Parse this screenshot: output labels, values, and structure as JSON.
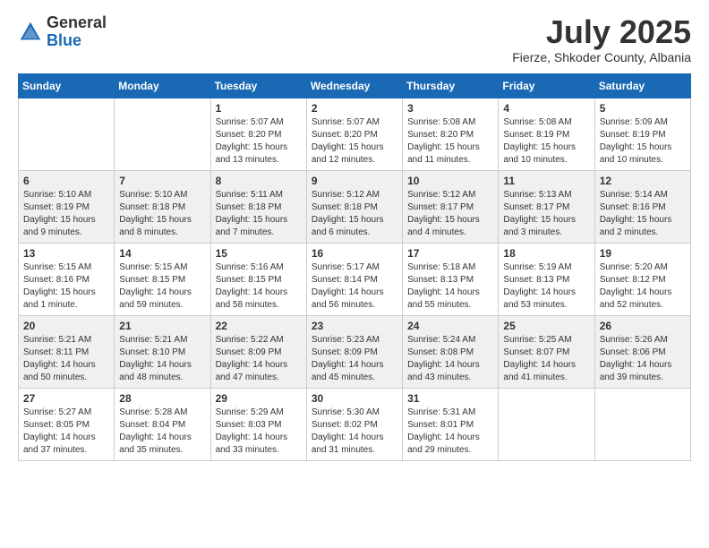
{
  "header": {
    "logo_general": "General",
    "logo_blue": "Blue",
    "month_title": "July 2025",
    "location": "Fierze, Shkoder County, Albania"
  },
  "weekdays": [
    "Sunday",
    "Monday",
    "Tuesday",
    "Wednesday",
    "Thursday",
    "Friday",
    "Saturday"
  ],
  "weeks": [
    [
      {
        "day": "",
        "sunrise": "",
        "sunset": "",
        "daylight": ""
      },
      {
        "day": "",
        "sunrise": "",
        "sunset": "",
        "daylight": ""
      },
      {
        "day": "1",
        "sunrise": "Sunrise: 5:07 AM",
        "sunset": "Sunset: 8:20 PM",
        "daylight": "Daylight: 15 hours and 13 minutes."
      },
      {
        "day": "2",
        "sunrise": "Sunrise: 5:07 AM",
        "sunset": "Sunset: 8:20 PM",
        "daylight": "Daylight: 15 hours and 12 minutes."
      },
      {
        "day": "3",
        "sunrise": "Sunrise: 5:08 AM",
        "sunset": "Sunset: 8:20 PM",
        "daylight": "Daylight: 15 hours and 11 minutes."
      },
      {
        "day": "4",
        "sunrise": "Sunrise: 5:08 AM",
        "sunset": "Sunset: 8:19 PM",
        "daylight": "Daylight: 15 hours and 10 minutes."
      },
      {
        "day": "5",
        "sunrise": "Sunrise: 5:09 AM",
        "sunset": "Sunset: 8:19 PM",
        "daylight": "Daylight: 15 hours and 10 minutes."
      }
    ],
    [
      {
        "day": "6",
        "sunrise": "Sunrise: 5:10 AM",
        "sunset": "Sunset: 8:19 PM",
        "daylight": "Daylight: 15 hours and 9 minutes."
      },
      {
        "day": "7",
        "sunrise": "Sunrise: 5:10 AM",
        "sunset": "Sunset: 8:18 PM",
        "daylight": "Daylight: 15 hours and 8 minutes."
      },
      {
        "day": "8",
        "sunrise": "Sunrise: 5:11 AM",
        "sunset": "Sunset: 8:18 PM",
        "daylight": "Daylight: 15 hours and 7 minutes."
      },
      {
        "day": "9",
        "sunrise": "Sunrise: 5:12 AM",
        "sunset": "Sunset: 8:18 PM",
        "daylight": "Daylight: 15 hours and 6 minutes."
      },
      {
        "day": "10",
        "sunrise": "Sunrise: 5:12 AM",
        "sunset": "Sunset: 8:17 PM",
        "daylight": "Daylight: 15 hours and 4 minutes."
      },
      {
        "day": "11",
        "sunrise": "Sunrise: 5:13 AM",
        "sunset": "Sunset: 8:17 PM",
        "daylight": "Daylight: 15 hours and 3 minutes."
      },
      {
        "day": "12",
        "sunrise": "Sunrise: 5:14 AM",
        "sunset": "Sunset: 8:16 PM",
        "daylight": "Daylight: 15 hours and 2 minutes."
      }
    ],
    [
      {
        "day": "13",
        "sunrise": "Sunrise: 5:15 AM",
        "sunset": "Sunset: 8:16 PM",
        "daylight": "Daylight: 15 hours and 1 minute."
      },
      {
        "day": "14",
        "sunrise": "Sunrise: 5:15 AM",
        "sunset": "Sunset: 8:15 PM",
        "daylight": "Daylight: 14 hours and 59 minutes."
      },
      {
        "day": "15",
        "sunrise": "Sunrise: 5:16 AM",
        "sunset": "Sunset: 8:15 PM",
        "daylight": "Daylight: 14 hours and 58 minutes."
      },
      {
        "day": "16",
        "sunrise": "Sunrise: 5:17 AM",
        "sunset": "Sunset: 8:14 PM",
        "daylight": "Daylight: 14 hours and 56 minutes."
      },
      {
        "day": "17",
        "sunrise": "Sunrise: 5:18 AM",
        "sunset": "Sunset: 8:13 PM",
        "daylight": "Daylight: 14 hours and 55 minutes."
      },
      {
        "day": "18",
        "sunrise": "Sunrise: 5:19 AM",
        "sunset": "Sunset: 8:13 PM",
        "daylight": "Daylight: 14 hours and 53 minutes."
      },
      {
        "day": "19",
        "sunrise": "Sunrise: 5:20 AM",
        "sunset": "Sunset: 8:12 PM",
        "daylight": "Daylight: 14 hours and 52 minutes."
      }
    ],
    [
      {
        "day": "20",
        "sunrise": "Sunrise: 5:21 AM",
        "sunset": "Sunset: 8:11 PM",
        "daylight": "Daylight: 14 hours and 50 minutes."
      },
      {
        "day": "21",
        "sunrise": "Sunrise: 5:21 AM",
        "sunset": "Sunset: 8:10 PM",
        "daylight": "Daylight: 14 hours and 48 minutes."
      },
      {
        "day": "22",
        "sunrise": "Sunrise: 5:22 AM",
        "sunset": "Sunset: 8:09 PM",
        "daylight": "Daylight: 14 hours and 47 minutes."
      },
      {
        "day": "23",
        "sunrise": "Sunrise: 5:23 AM",
        "sunset": "Sunset: 8:09 PM",
        "daylight": "Daylight: 14 hours and 45 minutes."
      },
      {
        "day": "24",
        "sunrise": "Sunrise: 5:24 AM",
        "sunset": "Sunset: 8:08 PM",
        "daylight": "Daylight: 14 hours and 43 minutes."
      },
      {
        "day": "25",
        "sunrise": "Sunrise: 5:25 AM",
        "sunset": "Sunset: 8:07 PM",
        "daylight": "Daylight: 14 hours and 41 minutes."
      },
      {
        "day": "26",
        "sunrise": "Sunrise: 5:26 AM",
        "sunset": "Sunset: 8:06 PM",
        "daylight": "Daylight: 14 hours and 39 minutes."
      }
    ],
    [
      {
        "day": "27",
        "sunrise": "Sunrise: 5:27 AM",
        "sunset": "Sunset: 8:05 PM",
        "daylight": "Daylight: 14 hours and 37 minutes."
      },
      {
        "day": "28",
        "sunrise": "Sunrise: 5:28 AM",
        "sunset": "Sunset: 8:04 PM",
        "daylight": "Daylight: 14 hours and 35 minutes."
      },
      {
        "day": "29",
        "sunrise": "Sunrise: 5:29 AM",
        "sunset": "Sunset: 8:03 PM",
        "daylight": "Daylight: 14 hours and 33 minutes."
      },
      {
        "day": "30",
        "sunrise": "Sunrise: 5:30 AM",
        "sunset": "Sunset: 8:02 PM",
        "daylight": "Daylight: 14 hours and 31 minutes."
      },
      {
        "day": "31",
        "sunrise": "Sunrise: 5:31 AM",
        "sunset": "Sunset: 8:01 PM",
        "daylight": "Daylight: 14 hours and 29 minutes."
      },
      {
        "day": "",
        "sunrise": "",
        "sunset": "",
        "daylight": ""
      },
      {
        "day": "",
        "sunrise": "",
        "sunset": "",
        "daylight": ""
      }
    ]
  ]
}
